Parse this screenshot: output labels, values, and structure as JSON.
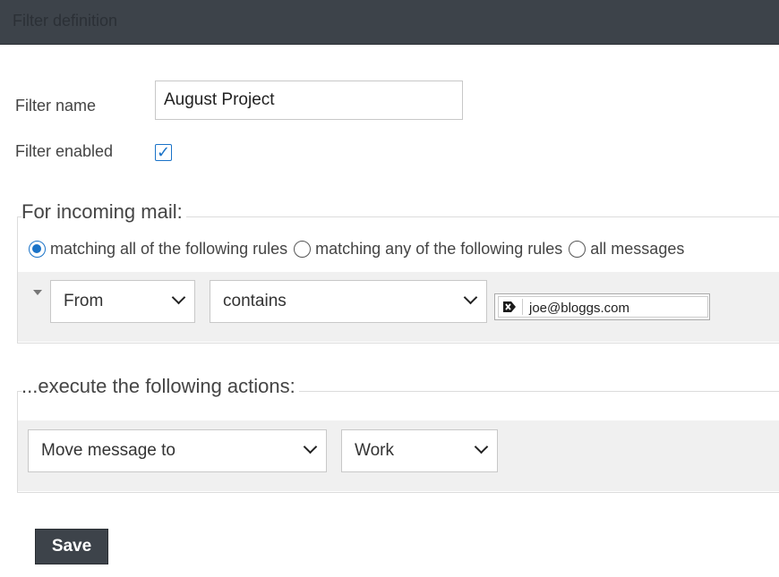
{
  "header": {
    "title": "Filter definition"
  },
  "filter": {
    "name_label": "Filter name",
    "name_value": "August Project",
    "enabled_label": "Filter enabled",
    "enabled": true
  },
  "incoming": {
    "legend": "For incoming mail:",
    "radio_options": [
      {
        "label": "matching all of the following rules",
        "selected": true
      },
      {
        "label": "matching any of the following rules",
        "selected": false
      },
      {
        "label": "all messages",
        "selected": false
      }
    ],
    "rule": {
      "field": "From",
      "operator": "contains",
      "value": "joe@bloggs.com"
    }
  },
  "actions": {
    "legend": "...execute the following actions:",
    "action": "Move message to",
    "target": "Work"
  },
  "buttons": {
    "save": "Save"
  },
  "colors": {
    "accent": "#1a73c8",
    "header_bg": "#3d434a",
    "band_bg": "#f0f0f0"
  }
}
